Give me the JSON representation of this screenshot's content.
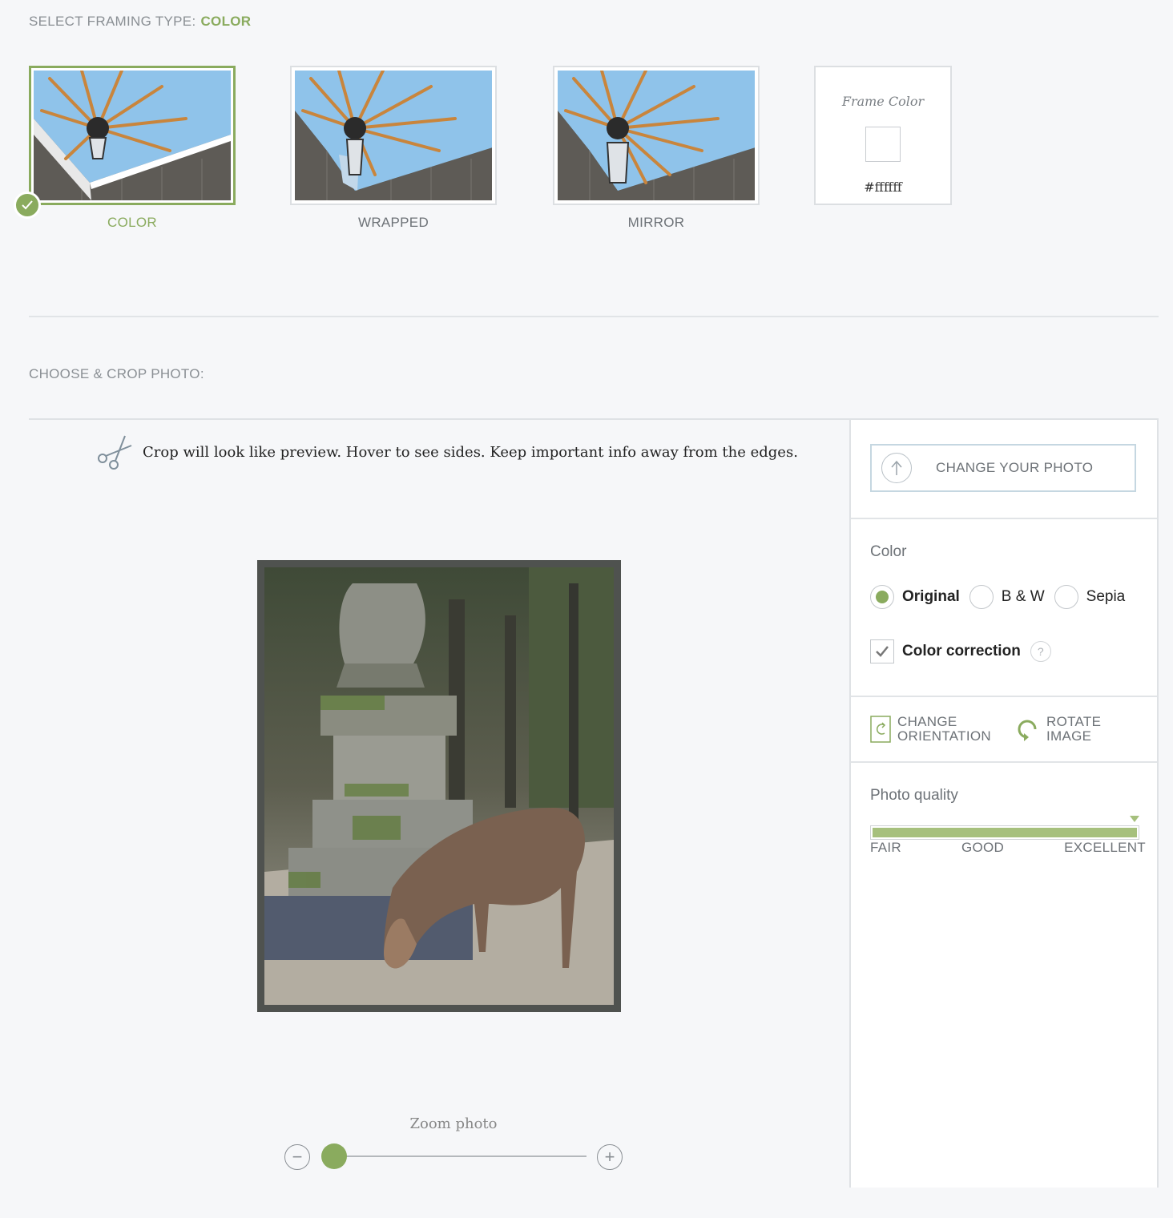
{
  "framing": {
    "label": "SELECT FRAMING TYPE:",
    "selected": "COLOR",
    "options": [
      {
        "caption": "COLOR"
      },
      {
        "caption": "WRAPPED"
      },
      {
        "caption": "MIRROR"
      }
    ],
    "frame_color": {
      "title": "Frame Color",
      "value": "#ffffff"
    }
  },
  "crop": {
    "label": "CHOOSE & CROP PHOTO:",
    "hint": "Crop will look like preview. Hover to see sides. Keep important info away from the edges.",
    "zoom_label": "Zoom photo",
    "zoom_level": 0
  },
  "panel": {
    "change_photo_label": "CHANGE YOUR PHOTO",
    "color_heading": "Color",
    "color_options": [
      "Original",
      "B & W",
      "Sepia"
    ],
    "color_selected": "Original",
    "color_correction_label": "Color correction",
    "color_correction_checked": true,
    "help_symbol": "?",
    "change_orientation_line1": "CHANGE",
    "change_orientation_line2": "ORIENTATION",
    "rotate_line1": "ROTATE",
    "rotate_line2": "IMAGE",
    "quality_heading": "Photo quality",
    "quality_labels": [
      "FAIR",
      "GOOD",
      "EXCELLENT"
    ],
    "quality_level": 1.0
  },
  "colors": {
    "accent": "#8aab5e",
    "quality_fill": "#a6c07d"
  },
  "icons": {
    "zoom_minus": "−",
    "zoom_plus": "+"
  }
}
